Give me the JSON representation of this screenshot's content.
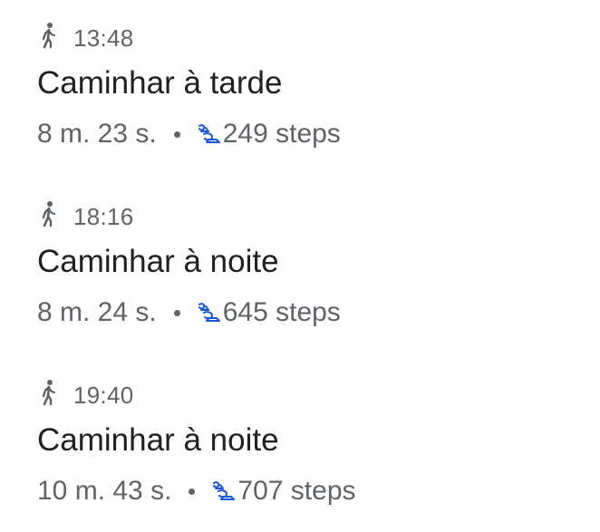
{
  "activities": [
    {
      "time": "13:48",
      "title": "Caminhar à tarde",
      "duration": "8 m. 23 s.",
      "steps": "249 steps",
      "activity_icon": "walking-icon",
      "steps_icon": "steps-icon"
    },
    {
      "time": "18:16",
      "title": "Caminhar à noite",
      "duration": "8 m. 24 s.",
      "steps": "645 steps",
      "activity_icon": "walking-icon",
      "steps_icon": "steps-icon"
    },
    {
      "time": "19:40",
      "title": "Caminhar à noite",
      "duration": "10 m. 43 s.",
      "steps": "707 steps",
      "activity_icon": "walking-icon",
      "steps_icon": "steps-icon"
    }
  ],
  "colors": {
    "primary_text": "#202124",
    "secondary_text": "#5f6368",
    "steps_accent": "#1a56db"
  }
}
